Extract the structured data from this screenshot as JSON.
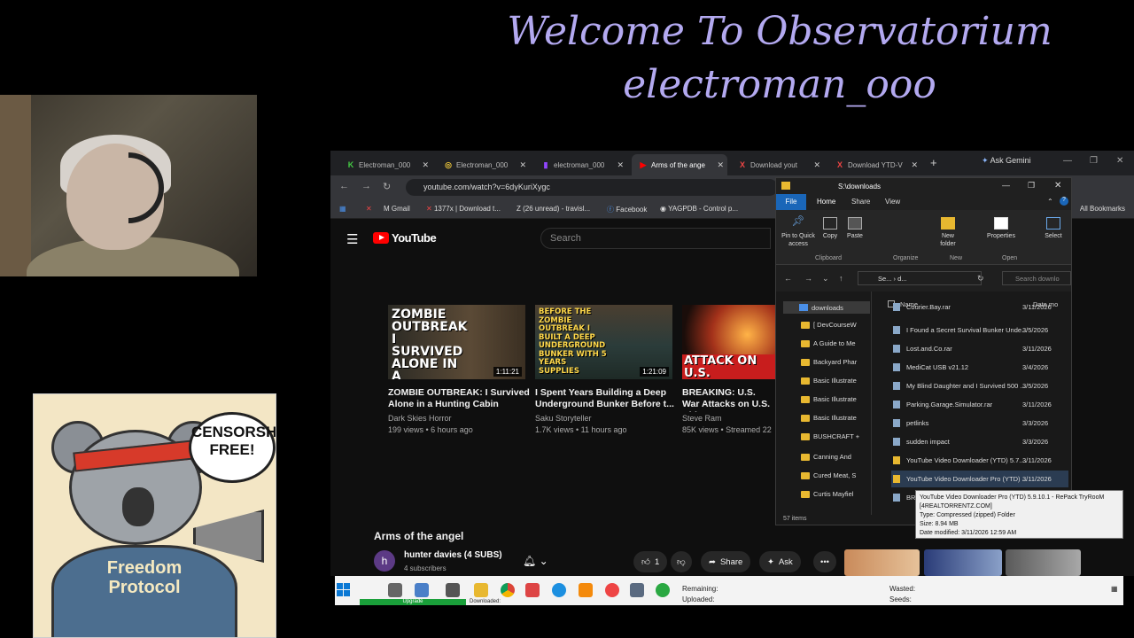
{
  "overlay": {
    "line1": "Welcome To Observatorium",
    "line2": "electroman_ooo"
  },
  "poster": {
    "bubble": "CENSORSHIP FREE!",
    "shirt": "Freedom Protocol"
  },
  "browser": {
    "tabs": [
      {
        "label": "Electroman_000",
        "icon": "kick-icon"
      },
      {
        "label": "Electroman_000",
        "icon": "rumble-icon"
      },
      {
        "label": "electroman_000",
        "icon": "twitch-icon"
      },
      {
        "label": "Arms of the ange",
        "icon": "youtube-icon"
      },
      {
        "label": "Download yout",
        "icon": "download-icon"
      },
      {
        "label": "Download YTD-V",
        "icon": "download-icon"
      }
    ],
    "ask_gemini": "Ask Gemini",
    "url": "youtube.com/watch?v=6dyKuriXygc",
    "bookmarks": [
      "Gmail",
      "1377x | Download t...",
      "(26 unread) - travisl...",
      "Facebook",
      "YAGPDB - Control p..."
    ],
    "all_bookmarks": "All Bookmarks"
  },
  "youtube": {
    "brand": "YouTube",
    "search_placeholder": "Search",
    "videos": [
      {
        "thumb_text": "ZOMBIE OUTBREAK I SURVIVED ALONE IN A HUNTING CABIN",
        "duration": "1:11:21",
        "title": "ZOMBIE OUTBREAK: I Survived Alone in a Hunting Cabin",
        "channel": "Dark Skies Horror",
        "meta": "199 views • 6 hours ago"
      },
      {
        "thumb_text": "BEFORE THE ZOMBIE OUTBREAK I BUILT A DEEP UNDERGROUND BUNKER WITH 5 YEARS SUPPLIES",
        "duration": "1:21:09",
        "title": "I Spent Years Building a Deep Underground Bunker Before t...",
        "channel": "Saku Storyteller",
        "meta": "1.7K views • 11 hours ago"
      },
      {
        "thumb_text": "ATTACK ON U.S.",
        "duration": "",
        "title": "BREAKING: U.S. War Attacks on U.S. Citie",
        "channel": "Steve Ram",
        "meta": "85K views • Streamed 22"
      }
    ],
    "video_title": "Arms of the angel",
    "channel_name": "hunter davies (4 SUBS)",
    "subscribers": "4 subscribers",
    "avatar_letter": "h",
    "likes": "1",
    "share": "Share",
    "ask": "Ask"
  },
  "explorer": {
    "title_path": "S:\\downloads",
    "ribbon_tabs": [
      "File",
      "Home",
      "Share",
      "View"
    ],
    "ribbon_buttons": [
      "Pin to Quick access",
      "Copy",
      "Paste",
      "New folder",
      "Properties",
      "Select"
    ],
    "ribbon_groups": [
      "Clipboard",
      "Organize",
      "New",
      "Open"
    ],
    "address": "Se... › d...",
    "search_placeholder": "Search downlo",
    "nav_root": "downloads",
    "nav_items": [
      "[ DevCourseW",
      "A Guide to Me",
      "Backyard Phar",
      "Basic Illustrate",
      "Basic Illustrate",
      "Basic Illustrate",
      "BUSHCRAFT +",
      "Canning And",
      "Cured Meat, S",
      "Curtis Mayfiel"
    ],
    "col_name": "Name",
    "col_date": "Date mo",
    "files": [
      {
        "name": "Courier.Bay.rar",
        "date": "3/11/2026",
        "type": "file"
      },
      {
        "name": "I Found a Secret Survival Bunker Unde...",
        "date": "3/5/2026",
        "type": "file"
      },
      {
        "name": "Lost.and.Co.rar",
        "date": "3/11/2026",
        "type": "file"
      },
      {
        "name": "MediCat USB v21.12",
        "date": "3/4/2026",
        "type": "file"
      },
      {
        "name": "My Blind Daughter and I Survived 500 ...",
        "date": "3/5/2026",
        "type": "file"
      },
      {
        "name": "Parking.Garage.Simulator.rar",
        "date": "3/11/2026",
        "type": "file"
      },
      {
        "name": "petlinks",
        "date": "3/3/2026",
        "type": "file"
      },
      {
        "name": "sudden impact",
        "date": "3/3/2026",
        "type": "file"
      },
      {
        "name": "YouTube Video Downloader (YTD) 5.7....",
        "date": "3/11/2026",
        "type": "folder"
      },
      {
        "name": "YouTube Video Downloader Pro (YTD) ...",
        "date": "3/11/2026",
        "type": "folder"
      },
      {
        "name": "BR",
        "date": "",
        "type": "file"
      }
    ],
    "status": "57 items"
  },
  "tooltip": {
    "line1": "YouTube Video Downloader Pro (YTD) 5.9.10.1 - RePack TryRooM",
    "line2": "[4REALTORRENTZ.COM]",
    "line3": "Type: Compressed (zipped) Folder",
    "line4": "Size: 8.94 MB",
    "line5": "Date modified: 3/11/2026 12:59 AM"
  },
  "taskbar": {
    "upgrade": "Upgrade",
    "downloaded": "Downloaded:",
    "remaining": "Remaining:",
    "uploaded": "Uploaded:",
    "wasted": "Wasted:",
    "seeds": "Seeds:"
  }
}
